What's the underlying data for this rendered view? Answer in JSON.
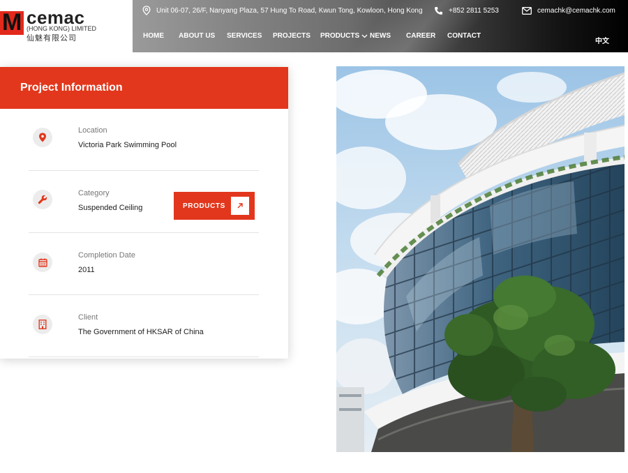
{
  "brand": {
    "name": "cemac",
    "subtitle": "(HONG KONG) LIMITED",
    "chinese": "仙魅有限公司",
    "logo_color": "#e2291b"
  },
  "contact": {
    "address": "Unit 06-07, 26/F, Nanyang Plaza, 57 Hung To Road, Kwun Tong, Kowloon, Hong Kong",
    "phone": "+852 2811 5253",
    "email": "cemachk@cemachk.com"
  },
  "nav": {
    "items": [
      {
        "label": "HOME"
      },
      {
        "label": "ABOUT US"
      },
      {
        "label": "SERVICES"
      },
      {
        "label": "PROJECTS"
      },
      {
        "label": "PRODUCTS",
        "has_dropdown": true
      },
      {
        "label": "NEWS"
      },
      {
        "label": "CAREER"
      },
      {
        "label": "CONTACT"
      }
    ],
    "language": "中文"
  },
  "project": {
    "heading": "Project Information",
    "accent_color": "#e2371c",
    "location": {
      "label": "Location",
      "value": "Victoria Park Swimming Pool",
      "icon": "location-pin-icon"
    },
    "category": {
      "label": "Category",
      "value": "Suspended Ceiling",
      "icon": "wrench-icon",
      "button_label": "PRODUCTS"
    },
    "completion": {
      "label": "Completion Date",
      "value": "2011",
      "icon": "calendar-icon"
    },
    "client": {
      "label": "Client",
      "value": "The Government of HKSAR of China",
      "icon": "building-icon"
    }
  },
  "photo": {
    "subject": "curved glass building with white roof and tree"
  }
}
